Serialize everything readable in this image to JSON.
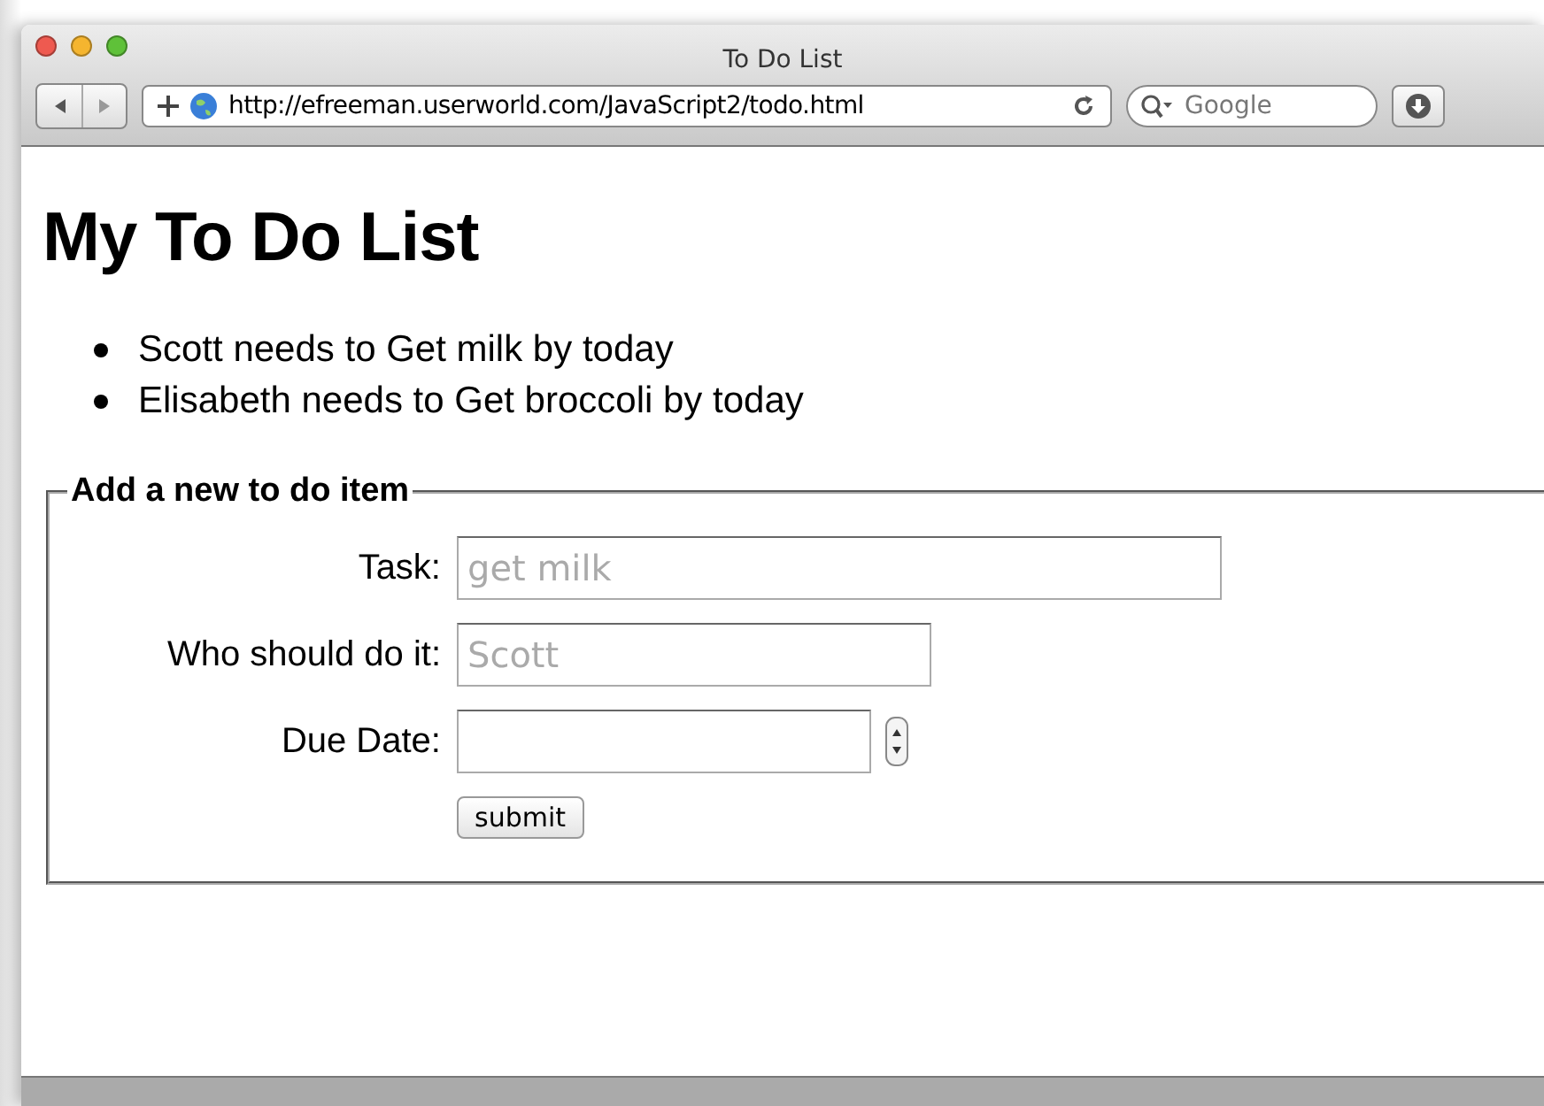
{
  "window": {
    "title": "To Do List"
  },
  "toolbar": {
    "url": "http://efreeman.userworld.com/JavaScript2/todo.html",
    "search_placeholder": "Google"
  },
  "page": {
    "heading": "My To Do List",
    "items": [
      "Scott needs to Get milk by today",
      "Elisabeth needs to Get broccoli by today"
    ],
    "form": {
      "legend": "Add a new to do item",
      "fields": [
        {
          "kind": "text",
          "label": "Task:",
          "placeholder": "get milk"
        },
        {
          "kind": "text",
          "label": "Who should do it:",
          "placeholder": "Scott"
        },
        {
          "kind": "date",
          "label": "Due Date:"
        }
      ],
      "submit": "submit"
    }
  }
}
